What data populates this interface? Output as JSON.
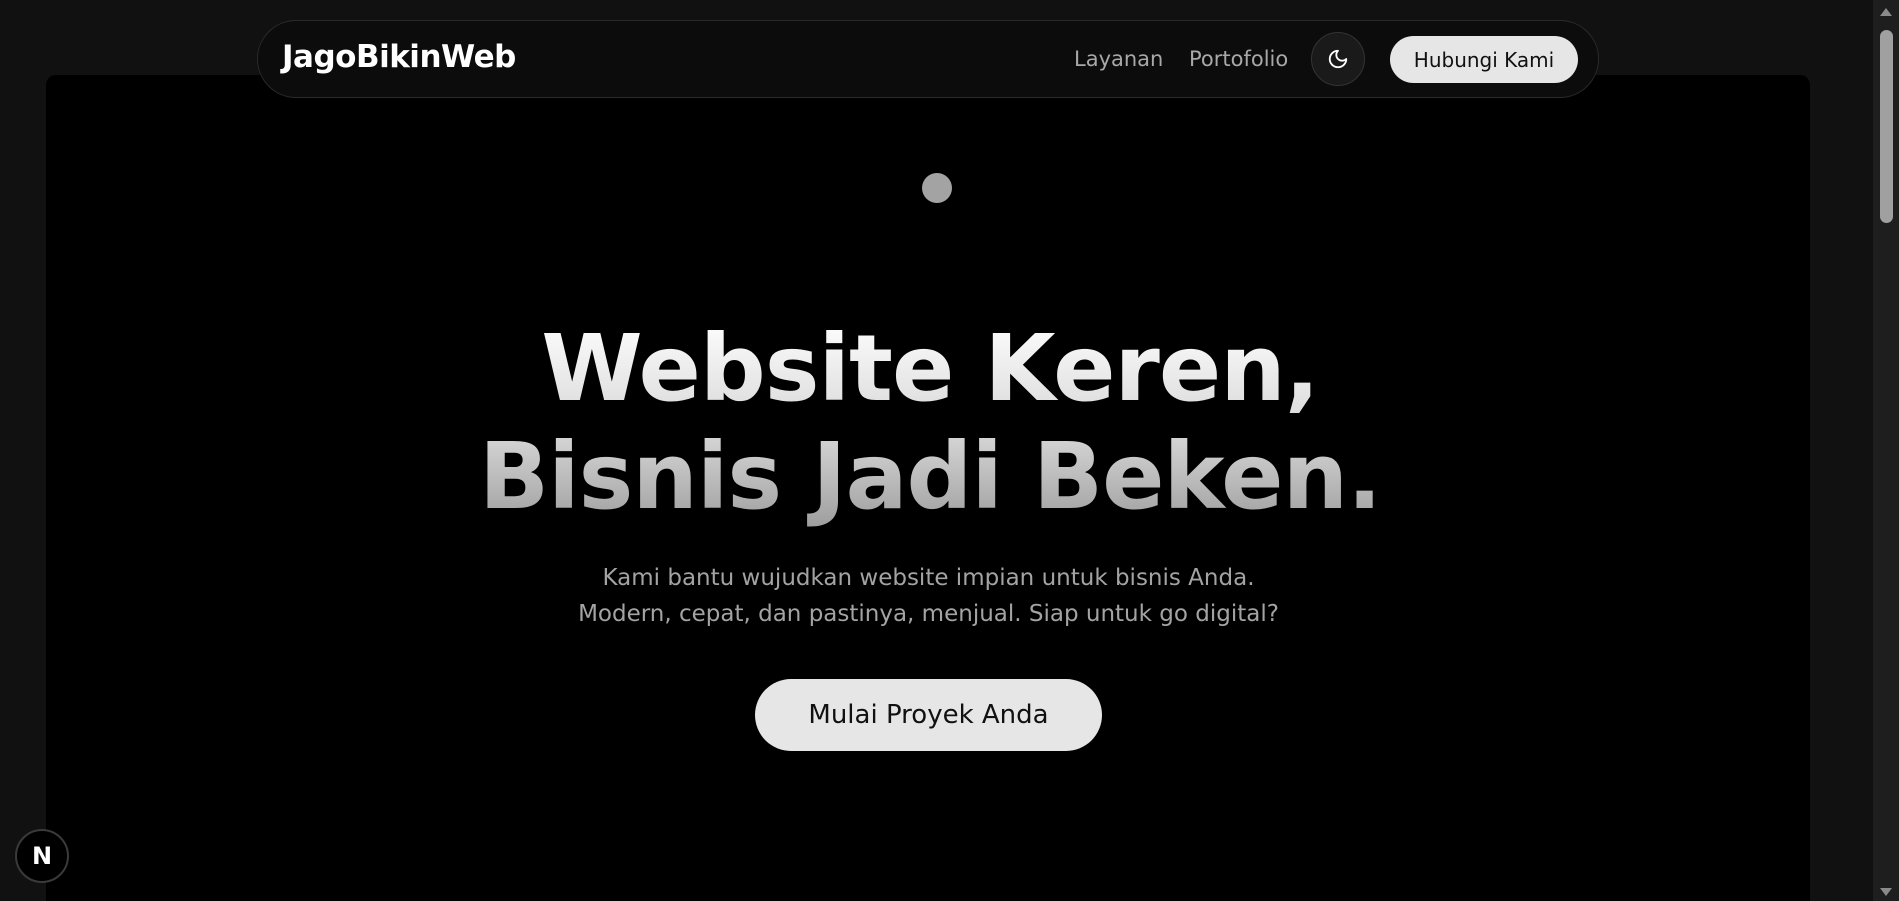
{
  "navbar": {
    "brand": "JagoBikinWeb",
    "links": [
      "Layanan",
      "Portofolio"
    ],
    "theme_icon": "moon-icon",
    "contact_label": "Hubungi Kami"
  },
  "hero": {
    "headline_line1": "Website Keren,",
    "headline_line2": "Bisnis Jadi Beken.",
    "subtitle_line1": "Kami bantu wujudkan website impian untuk bisnis Anda.",
    "subtitle_line2": "Modern, cepat, dan pastinya, menjual. Siap untuk go digital?",
    "cta_label": "Mulai Proyek Anda"
  },
  "badge": {
    "label": "N",
    "icon": "nextjs-logo-icon"
  },
  "colors": {
    "page_bg": "#111111",
    "hero_bg": "#000000",
    "button_bg": "#e6e6e6",
    "muted_text": "#a3a3a3"
  }
}
